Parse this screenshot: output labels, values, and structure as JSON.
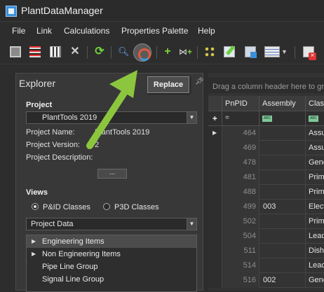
{
  "app": {
    "title": "PlantDataManager"
  },
  "menu": [
    "File",
    "Link",
    "Calculations",
    "Properties Palette",
    "Help"
  ],
  "toolbar": {
    "icons": [
      "save-icon",
      "lines-icon",
      "film-icon",
      "delete-icon",
      "refresh-icon",
      "search-icon",
      "replace-icon",
      "add-icon",
      "valve-add-icon",
      "dots-icon",
      "edit-icon",
      "document-icon",
      "table-icon",
      "close-document-icon"
    ],
    "tooltip": "Replace"
  },
  "explorer": {
    "title": "Explorer",
    "project_section": "Project",
    "project_selected": "PlantTools 2019",
    "info": [
      {
        "label": "Project Name:",
        "value": "PlantTools 2019"
      },
      {
        "label": "Project Version:",
        "value": "2"
      },
      {
        "label": "Project Description:",
        "value": ""
      }
    ],
    "more_button": "...",
    "views_section": "Views",
    "radio_pid": "P&ID Classes",
    "radio_p3d": "P3D Classes",
    "selected_radio": "P&ID Classes",
    "view_selected": "Project Data",
    "tree": [
      {
        "label": "Engineering Items",
        "expandable": true,
        "selected": true
      },
      {
        "label": "Non Engineering Items",
        "expandable": true,
        "selected": false
      },
      {
        "label": "Pipe Line Group",
        "expandable": false,
        "selected": false
      },
      {
        "label": "Signal Line Group",
        "expandable": false,
        "selected": false
      }
    ]
  },
  "grid": {
    "group_hint": "Drag a column header here to group by that column",
    "columns": [
      "PnPID",
      "Assembly",
      "Class"
    ],
    "filter_eq": "=",
    "filter_abc": "ABC",
    "rows": [
      {
        "pnpid": "464",
        "assembly": "",
        "class": "Assu"
      },
      {
        "pnpid": "469",
        "assembly": "",
        "class": "Assu"
      },
      {
        "pnpid": "478",
        "assembly": "",
        "class": "Gene"
      },
      {
        "pnpid": "481",
        "assembly": "",
        "class": "Prim"
      },
      {
        "pnpid": "488",
        "assembly": "",
        "class": "Prim"
      },
      {
        "pnpid": "499",
        "assembly": "003",
        "class": "Elect"
      },
      {
        "pnpid": "502",
        "assembly": "",
        "class": "Prim"
      },
      {
        "pnpid": "504",
        "assembly": "",
        "class": "Lead"
      },
      {
        "pnpid": "511",
        "assembly": "",
        "class": "Dish"
      },
      {
        "pnpid": "514",
        "assembly": "",
        "class": "Lead"
      },
      {
        "pnpid": "516",
        "assembly": "002",
        "class": "Gene"
      }
    ]
  },
  "colors": {
    "arrow": "#8cc63f",
    "background": "#2d2d2d",
    "panel": "#383838"
  }
}
